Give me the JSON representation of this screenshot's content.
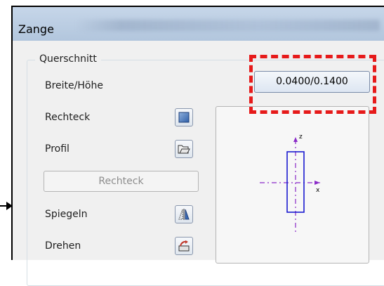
{
  "window": {
    "title": "Zange"
  },
  "group": {
    "legend": "Querschnitt"
  },
  "rows": {
    "breite_hoehe_label": "Breite/Höhe",
    "breite_hoehe_value": "0.0400/0.1400",
    "rechteck_label": "Rechteck",
    "profil_label": "Profil",
    "rechteck_button": "Rechteck",
    "spiegeln_label": "Spiegeln",
    "drehen_label": "Drehen"
  },
  "preview": {
    "axis_z": "z",
    "axis_x": "x"
  },
  "colors": {
    "highlight": "#e61a1a",
    "profile_stroke": "#1a1ad0",
    "axis": "#8a2ac8"
  }
}
